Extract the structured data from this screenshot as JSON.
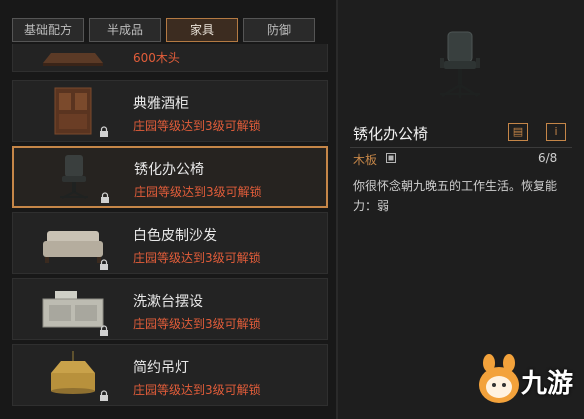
{
  "tabs": [
    {
      "label": "基础配方"
    },
    {
      "label": "半成品"
    },
    {
      "label": "家具",
      "active": true
    },
    {
      "label": "防御"
    }
  ],
  "items": [
    {
      "name": "",
      "requirement": "600木头"
    },
    {
      "name": "典雅酒柜",
      "requirement": "庄园等级达到3级可解锁"
    },
    {
      "name": "锈化办公椅",
      "requirement": "庄园等级达到3级可解锁",
      "selected": true
    },
    {
      "name": "白色皮制沙发",
      "requirement": "庄园等级达到3级可解锁"
    },
    {
      "name": "洗漱台摆设",
      "requirement": "庄园等级达到3级可解锁"
    },
    {
      "name": "简约吊灯",
      "requirement": "庄园等级达到3级可解锁"
    }
  ],
  "detail": {
    "title": "锈化办公椅",
    "material": "木板",
    "count": "6/8",
    "description": "你很怀念朝九晚五的工作生活。恢复能力：弱"
  },
  "watermark": {
    "text": "九游"
  },
  "colors": {
    "accent": "#c58648",
    "requirement": "#e25d3a"
  }
}
